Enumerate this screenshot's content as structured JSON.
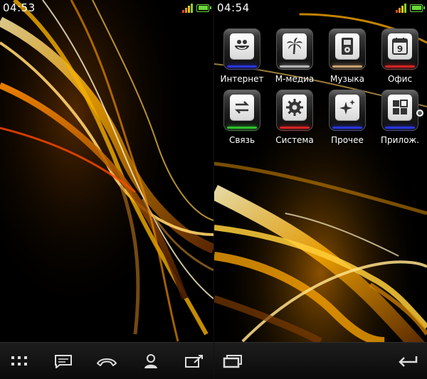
{
  "left_screen": {
    "status": {
      "time": "04:53"
    },
    "bottom_bar": {
      "icons": [
        "apps-grid-icon",
        "message-icon",
        "phone-icon",
        "contacts-icon",
        "compose-icon"
      ]
    }
  },
  "right_screen": {
    "status": {
      "time": "04:54"
    },
    "apps": [
      {
        "label": "Интернет",
        "icon": "internet-icon",
        "accent": "#2a35d8"
      },
      {
        "label": "М-медиа",
        "icon": "palm-icon",
        "accent": "#b6b6b6"
      },
      {
        "label": "Музыка",
        "icon": "music-player-icon",
        "accent": "#c8a070"
      },
      {
        "label": "Офис",
        "icon": "calendar-icon",
        "accent": "#d22424"
      },
      {
        "label": "Связь",
        "icon": "transfer-icon",
        "accent": "#2fbf2f"
      },
      {
        "label": "Система",
        "icon": "gear-icon",
        "accent": "#d22424"
      },
      {
        "label": "Прочее",
        "icon": "sparkle-icon",
        "accent": "#2a35d8"
      },
      {
        "label": "Прилож.",
        "icon": "applications-icon",
        "accent": "#2a35d8"
      }
    ],
    "calendar_day": "9",
    "bottom_bar": {
      "icons": [
        "windows-icon",
        "back-icon"
      ]
    }
  },
  "colors": {
    "wallpaper_gold": "#f2a400",
    "wallpaper_orange": "#e04a00",
    "signal_green": "#8ad61a",
    "battery_green": "#6bd63a"
  }
}
